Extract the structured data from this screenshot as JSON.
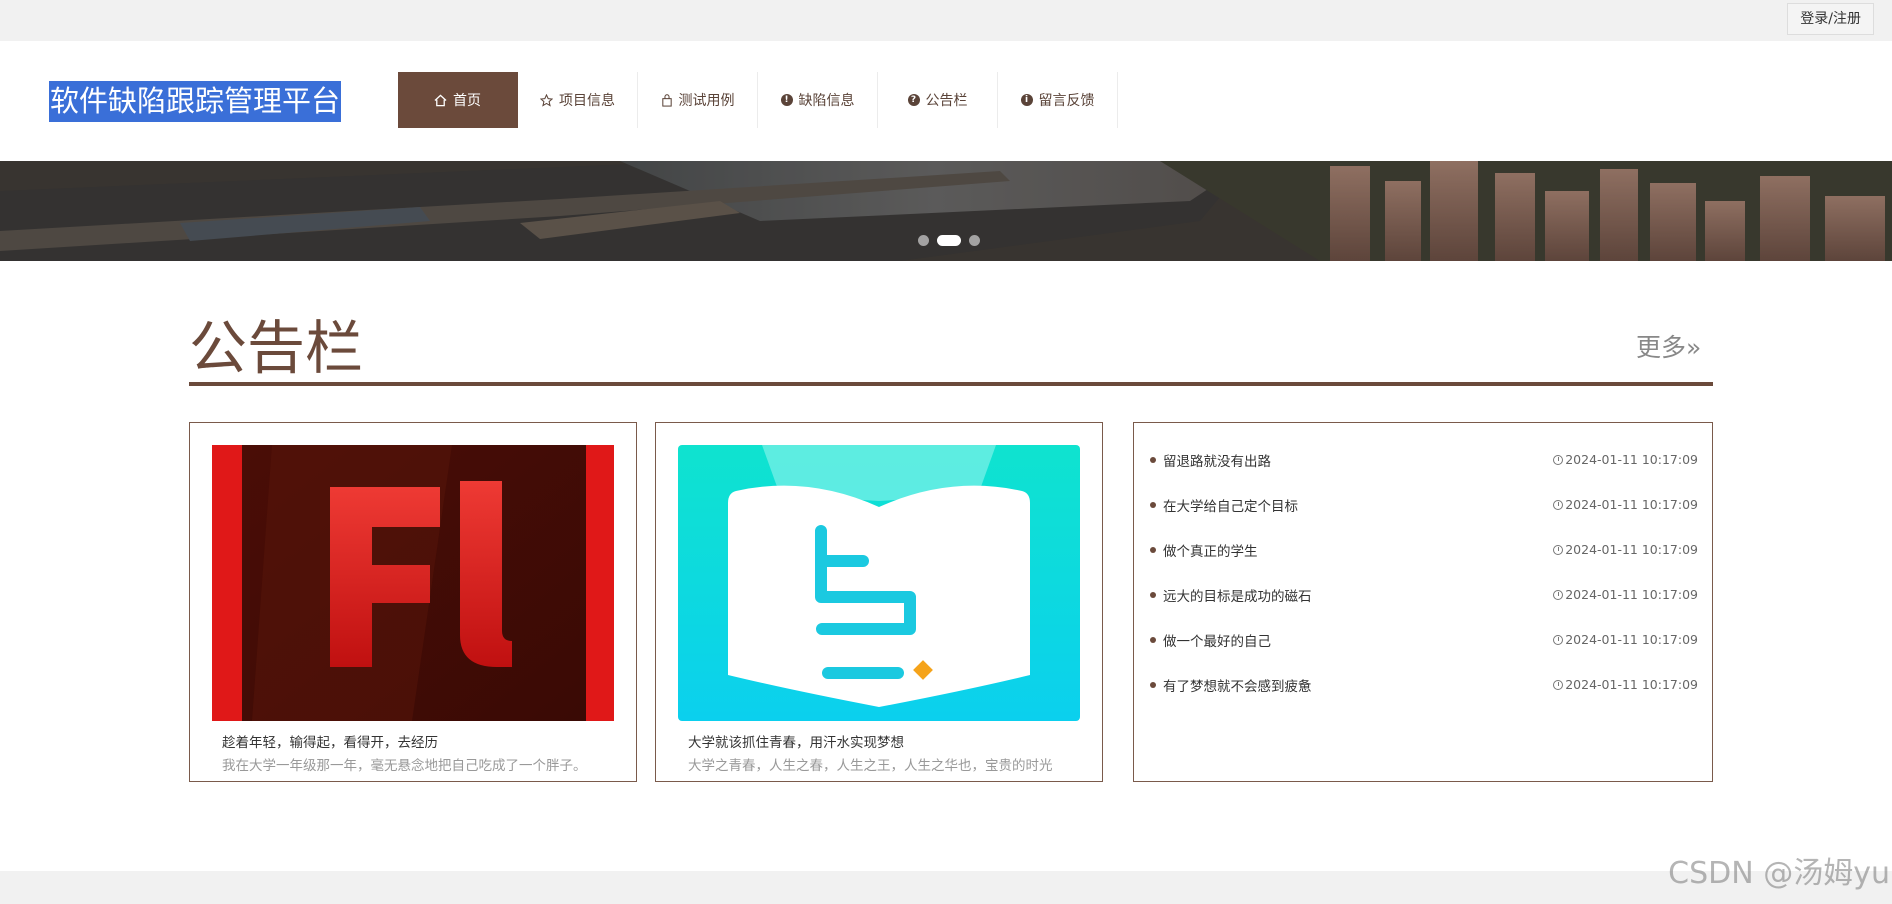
{
  "topbar": {
    "login_label": "登录/注册"
  },
  "header": {
    "logo": "软件缺陷跟踪管理平台",
    "nav": [
      {
        "label": "首页",
        "icon": "home-icon",
        "active": true
      },
      {
        "label": "项目信息",
        "icon": "star-icon",
        "active": false
      },
      {
        "label": "测试用例",
        "icon": "bag-icon",
        "active": false
      },
      {
        "label": "缺陷信息",
        "icon": "exclamation-icon",
        "active": false
      },
      {
        "label": "公告栏",
        "icon": "question-icon",
        "active": false
      },
      {
        "label": "留言反馈",
        "icon": "info-icon",
        "active": false
      }
    ]
  },
  "banner": {
    "slides": 3,
    "active_slide": 2
  },
  "notice": {
    "title": "公告栏",
    "more": "更多»",
    "cards": [
      {
        "title": "趁着年轻，输得起，看得开，去经历",
        "desc": "我在大学一年级那一年，毫无悬念地把自己吃成了一个胖子。"
      },
      {
        "title": "大学就该抓住青春，用汗水实现梦想",
        "desc": "大学之青春，人生之春，人生之王，人生之华也，宝贵的时光"
      }
    ],
    "list": [
      {
        "text": "留退路就没有出路",
        "time": "2024-01-11 10:17:09"
      },
      {
        "text": "在大学给自己定个目标",
        "time": "2024-01-11 10:17:09"
      },
      {
        "text": "做个真正的学生",
        "time": "2024-01-11 10:17:09"
      },
      {
        "text": "远大的目标是成功的磁石",
        "time": "2024-01-11 10:17:09"
      },
      {
        "text": "做一个最好的自己",
        "time": "2024-01-11 10:17:09"
      },
      {
        "text": "有了梦想就不会感到疲惫",
        "time": "2024-01-11 10:17:09"
      }
    ]
  },
  "watermark": "CSDN @汤姆yu",
  "colors": {
    "brand": "#6b4a3b",
    "logo_bg": "#3a6fd8",
    "topbar_bg": "#f1f1f1"
  }
}
